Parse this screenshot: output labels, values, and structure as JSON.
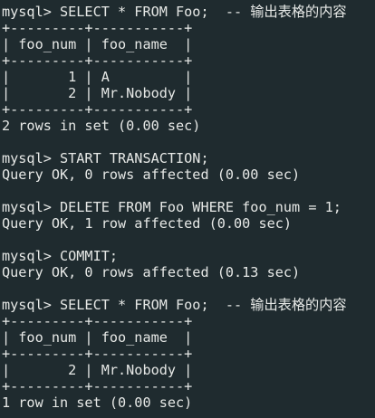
{
  "terminal": {
    "lines": [
      "mysql> SELECT * FROM Foo;  -- 输出表格的内容",
      "+---------+-----------+",
      "| foo_num | foo_name  |",
      "+---------+-----------+",
      "|       1 | A         |",
      "|       2 | Mr.Nobody |",
      "+---------+-----------+",
      "2 rows in set (0.00 sec)",
      "",
      "mysql> START TRANSACTION;",
      "Query OK, 0 rows affected (0.00 sec)",
      "",
      "mysql> DELETE FROM Foo WHERE foo_num = 1;",
      "Query OK, 1 row affected (0.00 sec)",
      "",
      "mysql> COMMIT;",
      "Query OK, 0 rows affected (0.13 sec)",
      "",
      "mysql> SELECT * FROM Foo;  -- 输出表格的内容",
      "+---------+-----------+",
      "| foo_num | foo_name  |",
      "+---------+-----------+",
      "|       2 | Mr.Nobody |",
      "+---------+-----------+",
      "1 row in set (0.00 sec)"
    ]
  },
  "colors": {
    "background": "#1f2b2f",
    "text": "#e6e8e6"
  }
}
